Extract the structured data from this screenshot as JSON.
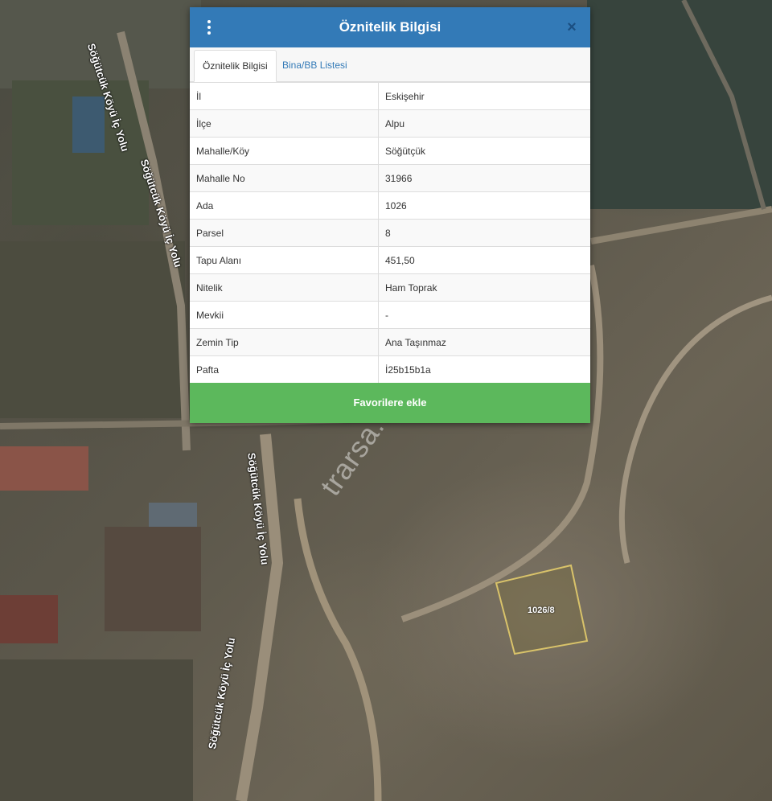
{
  "dialog": {
    "title": "Öznitelik Bilgisi",
    "menu_icon": "kebab-menu-icon",
    "close_icon": "close-icon",
    "close_glyph": "×"
  },
  "tabs": [
    {
      "label": "Öznitelik Bilgisi",
      "active": true
    },
    {
      "label": "Bina/BB Listesi",
      "active": false
    }
  ],
  "attributes": [
    {
      "key": "İl",
      "value": "Eskişehir"
    },
    {
      "key": "İlçe",
      "value": "Alpu"
    },
    {
      "key": "Mahalle/Köy",
      "value": "Söğütçük"
    },
    {
      "key": "Mahalle No",
      "value": "31966"
    },
    {
      "key": "Ada",
      "value": "1026"
    },
    {
      "key": "Parsel",
      "value": "8"
    },
    {
      "key": "Tapu Alanı",
      "value": "451,50"
    },
    {
      "key": "Nitelik",
      "value": "Ham Toprak"
    },
    {
      "key": "Mevkii",
      "value": "-"
    },
    {
      "key": "Zemin Tip",
      "value": "Ana Taşınmaz"
    },
    {
      "key": "Pafta",
      "value": "İ25b15b1a"
    }
  ],
  "favorite_button": "Favorilere ekle",
  "map": {
    "road_labels": [
      "Söğütcük Köyü İç Yolu",
      "Söğütcük Köyü İç Yolu",
      "Söğütcük Köyü İç Yolu",
      "Söğütcük Köyü İç Yolu"
    ],
    "parcel_label": "1026/8",
    "watermark": "trarsa.com"
  },
  "colors": {
    "header": "#337ab7",
    "button": "#5cb85c",
    "parcel_outline": "#d9c36a"
  }
}
